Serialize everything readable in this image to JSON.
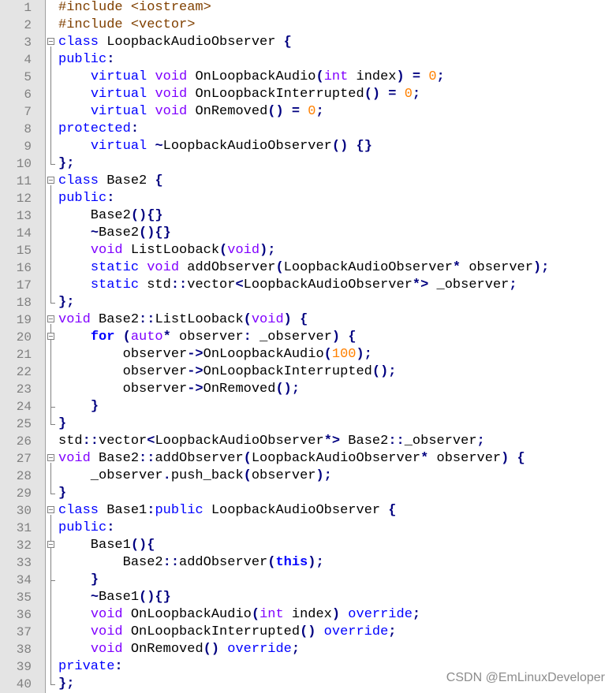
{
  "watermark": "CSDN @EmLinuxDeveloper",
  "colors": {
    "preprocessor": "#804000",
    "keyword": "#0000ff",
    "type": "#8000ff",
    "operator": "#000080",
    "number": "#ff8000",
    "gutter": "#e4e4e4",
    "line_number": "#808080"
  },
  "lines": [
    {
      "n": "1",
      "fold": "none",
      "tokens": [
        [
          "pre",
          "#include <iostream>"
        ]
      ]
    },
    {
      "n": "2",
      "fold": "none",
      "tokens": [
        [
          "pre",
          "#include <vector>"
        ]
      ]
    },
    {
      "n": "3",
      "fold": "open",
      "tokens": [
        [
          "kw",
          "class"
        ],
        [
          "id",
          " LoopbackAudioObserver "
        ],
        [
          "op",
          "{"
        ]
      ]
    },
    {
      "n": "4",
      "fold": "none",
      "tokens": [
        [
          "kw",
          "public"
        ],
        [
          "op",
          ":"
        ]
      ]
    },
    {
      "n": "5",
      "fold": "none",
      "tokens": [
        [
          "id",
          "    "
        ],
        [
          "kw",
          "virtual"
        ],
        [
          "id",
          " "
        ],
        [
          "type",
          "void"
        ],
        [
          "id",
          " OnLoopbackAudio"
        ],
        [
          "op",
          "("
        ],
        [
          "type",
          "int"
        ],
        [
          "id",
          " index"
        ],
        [
          "op",
          ")"
        ],
        [
          "id",
          " "
        ],
        [
          "op",
          "="
        ],
        [
          "id",
          " "
        ],
        [
          "num",
          "0"
        ],
        [
          "op",
          ";"
        ]
      ]
    },
    {
      "n": "6",
      "fold": "none",
      "tokens": [
        [
          "id",
          "    "
        ],
        [
          "kw",
          "virtual"
        ],
        [
          "id",
          " "
        ],
        [
          "type",
          "void"
        ],
        [
          "id",
          " OnLoopbackInterrupted"
        ],
        [
          "op",
          "()"
        ],
        [
          "id",
          " "
        ],
        [
          "op",
          "="
        ],
        [
          "id",
          " "
        ],
        [
          "num",
          "0"
        ],
        [
          "op",
          ";"
        ]
      ]
    },
    {
      "n": "7",
      "fold": "none",
      "tokens": [
        [
          "id",
          "    "
        ],
        [
          "kw",
          "virtual"
        ],
        [
          "id",
          " "
        ],
        [
          "type",
          "void"
        ],
        [
          "id",
          " OnRemoved"
        ],
        [
          "op",
          "()"
        ],
        [
          "id",
          " "
        ],
        [
          "op",
          "="
        ],
        [
          "id",
          " "
        ],
        [
          "num",
          "0"
        ],
        [
          "op",
          ";"
        ]
      ]
    },
    {
      "n": "8",
      "fold": "none",
      "tokens": [
        [
          "kw",
          "protected"
        ],
        [
          "op",
          ":"
        ]
      ]
    },
    {
      "n": "9",
      "fold": "none",
      "tokens": [
        [
          "id",
          "    "
        ],
        [
          "kw",
          "virtual"
        ],
        [
          "id",
          " "
        ],
        [
          "op",
          "~"
        ],
        [
          "id",
          "LoopbackAudioObserver"
        ],
        [
          "op",
          "()"
        ],
        [
          "id",
          " "
        ],
        [
          "op",
          "{}"
        ]
      ]
    },
    {
      "n": "10",
      "fold": "end",
      "tokens": [
        [
          "op",
          "};"
        ]
      ]
    },
    {
      "n": "11",
      "fold": "open",
      "tokens": [
        [
          "kw",
          "class"
        ],
        [
          "id",
          " Base2 "
        ],
        [
          "op",
          "{"
        ]
      ]
    },
    {
      "n": "12",
      "fold": "none",
      "tokens": [
        [
          "kw",
          "public"
        ],
        [
          "op",
          ":"
        ]
      ]
    },
    {
      "n": "13",
      "fold": "none",
      "tokens": [
        [
          "id",
          "    Base2"
        ],
        [
          "op",
          "(){}"
        ]
      ]
    },
    {
      "n": "14",
      "fold": "none",
      "tokens": [
        [
          "id",
          "    "
        ],
        [
          "op",
          "~"
        ],
        [
          "id",
          "Base2"
        ],
        [
          "op",
          "(){}"
        ]
      ]
    },
    {
      "n": "15",
      "fold": "none",
      "tokens": [
        [
          "id",
          "    "
        ],
        [
          "type",
          "void"
        ],
        [
          "id",
          " ListLooback"
        ],
        [
          "op",
          "("
        ],
        [
          "type",
          "void"
        ],
        [
          "op",
          ");"
        ]
      ]
    },
    {
      "n": "16",
      "fold": "none",
      "tokens": [
        [
          "id",
          "    "
        ],
        [
          "kw",
          "static"
        ],
        [
          "id",
          " "
        ],
        [
          "type",
          "void"
        ],
        [
          "id",
          " addObserver"
        ],
        [
          "op",
          "("
        ],
        [
          "id",
          "LoopbackAudioObserver"
        ],
        [
          "op",
          "*"
        ],
        [
          "id",
          " observer"
        ],
        [
          "op",
          ");"
        ]
      ]
    },
    {
      "n": "17",
      "fold": "none",
      "tokens": [
        [
          "id",
          "    "
        ],
        [
          "kw",
          "static"
        ],
        [
          "id",
          " std"
        ],
        [
          "op",
          "::"
        ],
        [
          "id",
          "vector"
        ],
        [
          "op",
          "<"
        ],
        [
          "id",
          "LoopbackAudioObserver"
        ],
        [
          "op",
          "*>"
        ],
        [
          "id",
          " _observer"
        ],
        [
          "op",
          ";"
        ]
      ]
    },
    {
      "n": "18",
      "fold": "end",
      "tokens": [
        [
          "op",
          "};"
        ]
      ]
    },
    {
      "n": "19",
      "fold": "open",
      "tokens": [
        [
          "type",
          "void"
        ],
        [
          "id",
          " Base2"
        ],
        [
          "op",
          "::"
        ],
        [
          "id",
          "ListLooback"
        ],
        [
          "op",
          "("
        ],
        [
          "type",
          "void"
        ],
        [
          "op",
          ")"
        ],
        [
          "id",
          " "
        ],
        [
          "op",
          "{"
        ]
      ]
    },
    {
      "n": "20",
      "fold": "open",
      "tokens": [
        [
          "id",
          "    "
        ],
        [
          "bold",
          "for"
        ],
        [
          "id",
          " "
        ],
        [
          "op",
          "("
        ],
        [
          "type",
          "auto"
        ],
        [
          "op",
          "*"
        ],
        [
          "id",
          " observer"
        ],
        [
          "op",
          ":"
        ],
        [
          "id",
          " _observer"
        ],
        [
          "op",
          ")"
        ],
        [
          "id",
          " "
        ],
        [
          "op",
          "{"
        ]
      ]
    },
    {
      "n": "21",
      "fold": "none",
      "tokens": [
        [
          "id",
          "        observer"
        ],
        [
          "op",
          "->"
        ],
        [
          "id",
          "OnLoopbackAudio"
        ],
        [
          "op",
          "("
        ],
        [
          "num",
          "100"
        ],
        [
          "op",
          ");"
        ]
      ]
    },
    {
      "n": "22",
      "fold": "none",
      "tokens": [
        [
          "id",
          "        observer"
        ],
        [
          "op",
          "->"
        ],
        [
          "id",
          "OnLoopbackInterrupted"
        ],
        [
          "op",
          "();"
        ]
      ]
    },
    {
      "n": "23",
      "fold": "none",
      "tokens": [
        [
          "id",
          "        observer"
        ],
        [
          "op",
          "->"
        ],
        [
          "id",
          "OnRemoved"
        ],
        [
          "op",
          "();"
        ]
      ]
    },
    {
      "n": "24",
      "fold": "end",
      "tokens": [
        [
          "id",
          "    "
        ],
        [
          "op",
          "}"
        ]
      ]
    },
    {
      "n": "25",
      "fold": "end",
      "tokens": [
        [
          "op",
          "}"
        ]
      ]
    },
    {
      "n": "26",
      "fold": "none",
      "tokens": [
        [
          "id",
          "std"
        ],
        [
          "op",
          "::"
        ],
        [
          "id",
          "vector"
        ],
        [
          "op",
          "<"
        ],
        [
          "id",
          "LoopbackAudioObserver"
        ],
        [
          "op",
          "*>"
        ],
        [
          "id",
          " Base2"
        ],
        [
          "op",
          "::"
        ],
        [
          "id",
          "_observer"
        ],
        [
          "op",
          ";"
        ]
      ]
    },
    {
      "n": "27",
      "fold": "open",
      "tokens": [
        [
          "type",
          "void"
        ],
        [
          "id",
          " Base2"
        ],
        [
          "op",
          "::"
        ],
        [
          "id",
          "addObserver"
        ],
        [
          "op",
          "("
        ],
        [
          "id",
          "LoopbackAudioObserver"
        ],
        [
          "op",
          "*"
        ],
        [
          "id",
          " observer"
        ],
        [
          "op",
          ")"
        ],
        [
          "id",
          " "
        ],
        [
          "op",
          "{"
        ]
      ]
    },
    {
      "n": "28",
      "fold": "none",
      "tokens": [
        [
          "id",
          "    _observer"
        ],
        [
          "op",
          "."
        ],
        [
          "id",
          "push_back"
        ],
        [
          "op",
          "("
        ],
        [
          "id",
          "observer"
        ],
        [
          "op",
          ");"
        ]
      ]
    },
    {
      "n": "29",
      "fold": "end",
      "tokens": [
        [
          "op",
          "}"
        ]
      ]
    },
    {
      "n": "30",
      "fold": "open",
      "tokens": [
        [
          "kw",
          "class"
        ],
        [
          "id",
          " Base1"
        ],
        [
          "op",
          ":"
        ],
        [
          "kw",
          "public"
        ],
        [
          "id",
          " LoopbackAudioObserver "
        ],
        [
          "op",
          "{"
        ]
      ]
    },
    {
      "n": "31",
      "fold": "none",
      "tokens": [
        [
          "kw",
          "public"
        ],
        [
          "op",
          ":"
        ]
      ]
    },
    {
      "n": "32",
      "fold": "open",
      "tokens": [
        [
          "id",
          "    Base1"
        ],
        [
          "op",
          "(){"
        ]
      ]
    },
    {
      "n": "33",
      "fold": "none",
      "tokens": [
        [
          "id",
          "        Base2"
        ],
        [
          "op",
          "::"
        ],
        [
          "id",
          "addObserver"
        ],
        [
          "op",
          "("
        ],
        [
          "bold",
          "this"
        ],
        [
          "op",
          ");"
        ]
      ]
    },
    {
      "n": "34",
      "fold": "end",
      "tokens": [
        [
          "id",
          "    "
        ],
        [
          "op",
          "}"
        ]
      ]
    },
    {
      "n": "35",
      "fold": "none",
      "tokens": [
        [
          "id",
          "    "
        ],
        [
          "op",
          "~"
        ],
        [
          "id",
          "Base1"
        ],
        [
          "op",
          "(){}"
        ]
      ]
    },
    {
      "n": "36",
      "fold": "none",
      "tokens": [
        [
          "id",
          "    "
        ],
        [
          "type",
          "void"
        ],
        [
          "id",
          " OnLoopbackAudio"
        ],
        [
          "op",
          "("
        ],
        [
          "type",
          "int"
        ],
        [
          "id",
          " index"
        ],
        [
          "op",
          ")"
        ],
        [
          "id",
          " "
        ],
        [
          "kw",
          "override"
        ],
        [
          "op",
          ";"
        ]
      ]
    },
    {
      "n": "37",
      "fold": "none",
      "tokens": [
        [
          "id",
          "    "
        ],
        [
          "type",
          "void"
        ],
        [
          "id",
          " OnLoopbackInterrupted"
        ],
        [
          "op",
          "()"
        ],
        [
          "id",
          " "
        ],
        [
          "kw",
          "override"
        ],
        [
          "op",
          ";"
        ]
      ]
    },
    {
      "n": "38",
      "fold": "none",
      "tokens": [
        [
          "id",
          "    "
        ],
        [
          "type",
          "void"
        ],
        [
          "id",
          " OnRemoved"
        ],
        [
          "op",
          "()"
        ],
        [
          "id",
          " "
        ],
        [
          "kw",
          "override"
        ],
        [
          "op",
          ";"
        ]
      ]
    },
    {
      "n": "39",
      "fold": "none",
      "tokens": [
        [
          "kw",
          "private"
        ],
        [
          "op",
          ":"
        ]
      ]
    },
    {
      "n": "40",
      "fold": "end",
      "tokens": [
        [
          "op",
          "};"
        ]
      ]
    }
  ]
}
